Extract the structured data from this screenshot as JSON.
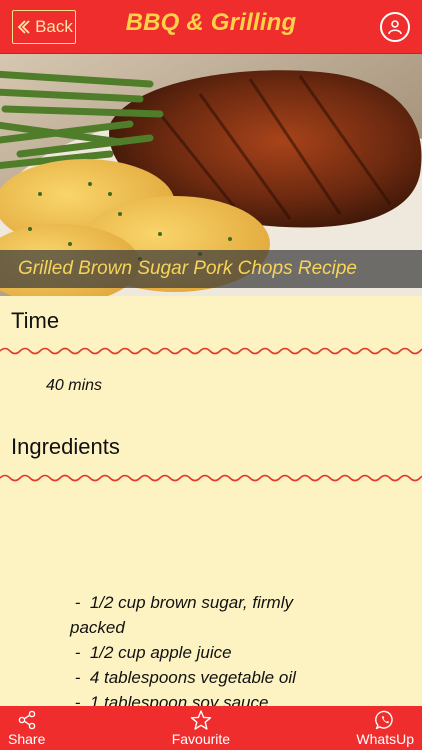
{
  "header": {
    "back_label": "Back",
    "title": "BBQ & Grilling",
    "profile_icon": "profile-icon"
  },
  "hero": {
    "caption": "Grilled Brown Sugar Pork Chops Recipe"
  },
  "sections": {
    "time_heading": "Time",
    "time_value": "40 mins",
    "ingredients_heading": "Ingredients"
  },
  "ingredients": [
    " -  1/2 cup brown sugar, firmly",
    "packed",
    " -  1/2 cup apple juice",
    " -  4 tablespoons vegetable oil",
    " -  1 tablespoon soy sauce"
  ],
  "tabbar": {
    "share_label": "Share",
    "favourite_label": "Favourite",
    "whatsapp_label": "WhatsUp"
  },
  "colors": {
    "header_bg": "#ef2d2d",
    "title": "#fbd24a",
    "content_bg": "#fdf3c2",
    "wave": "#e23a2a"
  }
}
